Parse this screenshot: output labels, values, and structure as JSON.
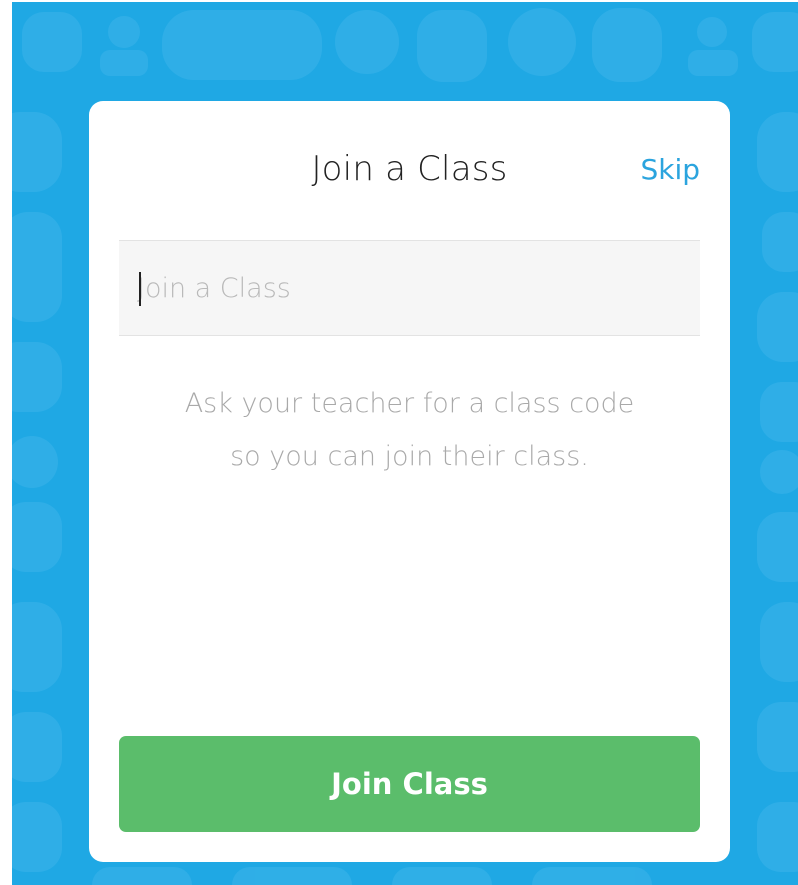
{
  "dialog": {
    "title": "Join a Class",
    "skip_label": "Skip",
    "code_input": {
      "placeholder": "Join a Class",
      "value": ""
    },
    "hint": "Ask your teacher for a class code so you can join their class.",
    "join_button_label": "Join Class"
  },
  "colors": {
    "background": "#1fa8e4",
    "link": "#2ba4de",
    "primary_button": "#5bbd6b",
    "input_background": "#f6f6f6"
  },
  "icons": {
    "background_pattern": "monster-silhouettes-pattern"
  }
}
